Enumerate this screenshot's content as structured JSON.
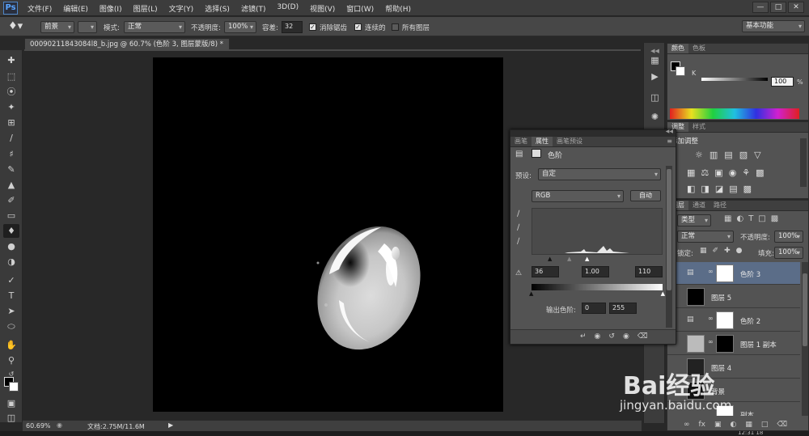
{
  "app": {
    "logo": "Ps"
  },
  "menu": [
    "文件(F)",
    "编辑(E)",
    "图像(I)",
    "图层(L)",
    "文字(Y)",
    "选择(S)",
    "滤镜(T)",
    "3D(D)",
    "视图(V)",
    "窗口(W)",
    "帮助(H)"
  ],
  "window_controls": [
    "—",
    "□",
    "✕"
  ],
  "options_bar": {
    "source_select": "前景",
    "mode_label": "模式:",
    "mode_value": "正常",
    "opacity_label": "不透明度:",
    "opacity_value": "100%",
    "tolerance_label": "容差:",
    "tolerance_value": "32",
    "antialias_label": "消除锯齿",
    "contiguous_label": "连续的",
    "all_layers_label": "所有图层",
    "workspace": "基本功能"
  },
  "document": {
    "tab_title": "00090211843084l8_b.jpg @ 60.7% (色阶 3, 图层蒙版/8) *",
    "zoom": "60.69%",
    "doc_info": "文档:2.75M/11.6M"
  },
  "color_panel": {
    "tabs": [
      "颜色",
      "色板"
    ],
    "channel_label": "K",
    "value": "100",
    "unit": "%"
  },
  "adjust_panel": {
    "tabs": [
      "调整",
      "样式"
    ],
    "heading": "添加调整"
  },
  "properties": {
    "tabs": [
      "画笔",
      "属性",
      "画笔预设"
    ],
    "title": "色阶",
    "preset_label": "预设:",
    "preset_value": "自定",
    "channel_value": "RGB",
    "auto_button": "自动",
    "input_black": "36",
    "input_gamma": "1.00",
    "input_white": "110",
    "output_label": "输出色阶:",
    "output_black": "0",
    "output_white": "255"
  },
  "layers_panel": {
    "tabs": [
      "图层",
      "通道",
      "路径"
    ],
    "filter": "类型",
    "blend_mode": "正常",
    "opacity_label": "不透明度:",
    "opacity_value": "100%",
    "lock_label": "锁定:",
    "fill_label": "填充:",
    "fill_value": "100%",
    "layers": [
      {
        "name": "色阶 3"
      },
      {
        "name": "图层 5"
      },
      {
        "name": "色阶 2"
      },
      {
        "name": "图层 1 副本"
      },
      {
        "name": "图层 4"
      },
      {
        "name": "背景"
      },
      {
        "name": "副本"
      }
    ]
  },
  "watermark": {
    "brand": "Bai经验",
    "url": "jingyan.baidu.com"
  },
  "taskbar_time": "12:31 18"
}
